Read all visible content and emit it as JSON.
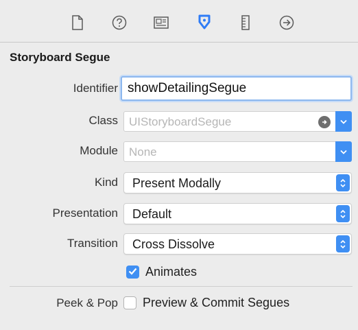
{
  "inspector": {
    "tabs": [
      {
        "icon": "file-icon"
      },
      {
        "icon": "help-icon"
      },
      {
        "icon": "identity-icon"
      },
      {
        "icon": "attributes-icon"
      },
      {
        "icon": "size-ruler-icon"
      },
      {
        "icon": "connections-arrow-icon"
      }
    ],
    "active_tab_color": "#2f7cf6"
  },
  "segue": {
    "section_title": "Storyboard Segue",
    "identifier": {
      "label": "Identifier",
      "value": "showDetailingSegue"
    },
    "class": {
      "label": "Class",
      "placeholder": "UIStoryboardSegue"
    },
    "module": {
      "label": "Module",
      "placeholder": "None"
    },
    "kind": {
      "label": "Kind",
      "value": "Present Modally"
    },
    "presentation": {
      "label": "Presentation",
      "value": "Default"
    },
    "transition": {
      "label": "Transition",
      "value": "Cross Dissolve"
    },
    "animates": {
      "label": "Animates",
      "checked": true
    },
    "peek_pop": {
      "label": "Peek & Pop",
      "option_label": "Preview & Commit Segues",
      "checked": false
    }
  },
  "colors": {
    "accent": "#3f8ff3",
    "background": "#ececec"
  }
}
